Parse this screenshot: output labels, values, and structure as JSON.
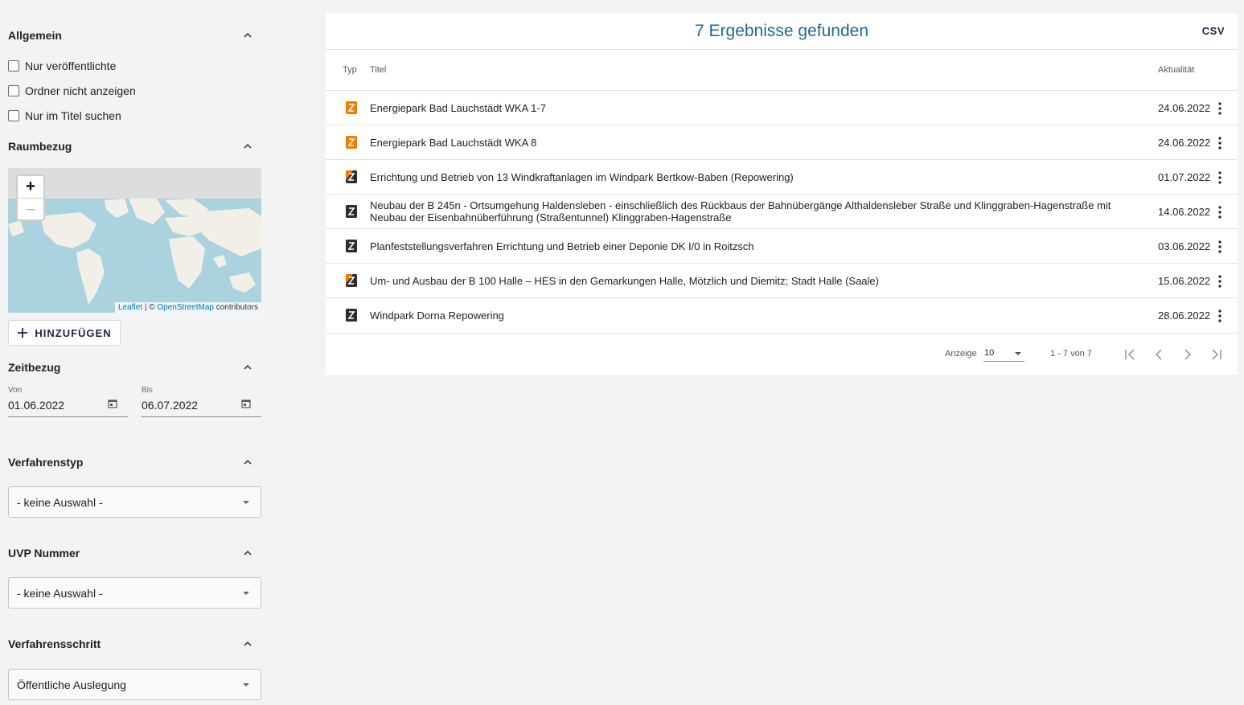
{
  "sidebar": {
    "general": {
      "title": "Allgemein",
      "options": [
        "Nur veröffentlichte",
        "Ordner nicht anzeigen",
        "Nur im Titel suchen"
      ]
    },
    "spatial": {
      "title": "Raumbezug",
      "zoom_in": "+",
      "zoom_out": "–",
      "attribution_leaflet": "Leaflet",
      "attribution_sep": " | © ",
      "attribution_osm": "OpenStreetMap",
      "attribution_suffix": " contributors",
      "add_label": "HINZUFÜGEN"
    },
    "time": {
      "title": "Zeitbezug",
      "from_label": "Von",
      "from_value": "01.06.2022",
      "to_label": "Bis",
      "to_value": "06.07.2022"
    },
    "procedure_type": {
      "title": "Verfahrenstyp",
      "value": "- keine Auswahl -"
    },
    "uvp_number": {
      "title": "UVP Nummer",
      "value": "- keine Auswahl -"
    },
    "procedure_step": {
      "title": "Verfahrensschritt",
      "value": "Öffentliche Auslegung"
    }
  },
  "results": {
    "title": "7 Ergebnisse gefunden",
    "csv_label": "CSV",
    "columns": {
      "type": "Typ",
      "title": "Titel",
      "date": "Aktualität"
    },
    "rows": [
      {
        "title": "Energiepark Bad Lauchstädt WKA 1-7",
        "date": "24.06.2022",
        "icon": "doc-orange-icon"
      },
      {
        "title": "Energiepark Bad Lauchstädt WKA 8",
        "date": "24.06.2022",
        "icon": "doc-orange-icon"
      },
      {
        "title": "Errichtung und Betrieb von 13 Windkraftanlagen im Windpark Bertkow-Baben (Repowering)",
        "date": "01.07.2022",
        "icon": "doc-mixed-icon"
      },
      {
        "title": "Neubau der B 245n - Ortsumgehung Haldensleben - einschließlich des Rückbaus der Bahnübergänge Althaldensleber Straße und Klinggraben-Hagenstraße mit Neubau der Eisenbahnüberführung (Straßentunnel) Klinggraben-Hagenstraße",
        "date": "14.06.2022",
        "icon": "doc-dark-icon"
      },
      {
        "title": "Planfeststellungsverfahren Errichtung und Betrieb einer Deponie DK I/0 in Roitzsch",
        "date": "03.06.2022",
        "icon": "doc-dark-icon"
      },
      {
        "title": "Um- und Ausbau der B 100 Halle – HES in den Gemarkungen Halle, Mötzlich und Diemitz; Stadt Halle (Saale)",
        "date": "15.06.2022",
        "icon": "doc-mixed-icon"
      },
      {
        "title": "Windpark Dorna Repowering",
        "date": "28.06.2022",
        "icon": "doc-dark-icon"
      }
    ],
    "pagination": {
      "per_page_label": "Anzeige",
      "per_page_value": "10",
      "range_label": "1 - 7 von 7"
    }
  },
  "colors": {
    "accent_blue": "#1f6a94",
    "icon_orange": "#f07d00",
    "icon_dark": "#2d2d2d"
  }
}
